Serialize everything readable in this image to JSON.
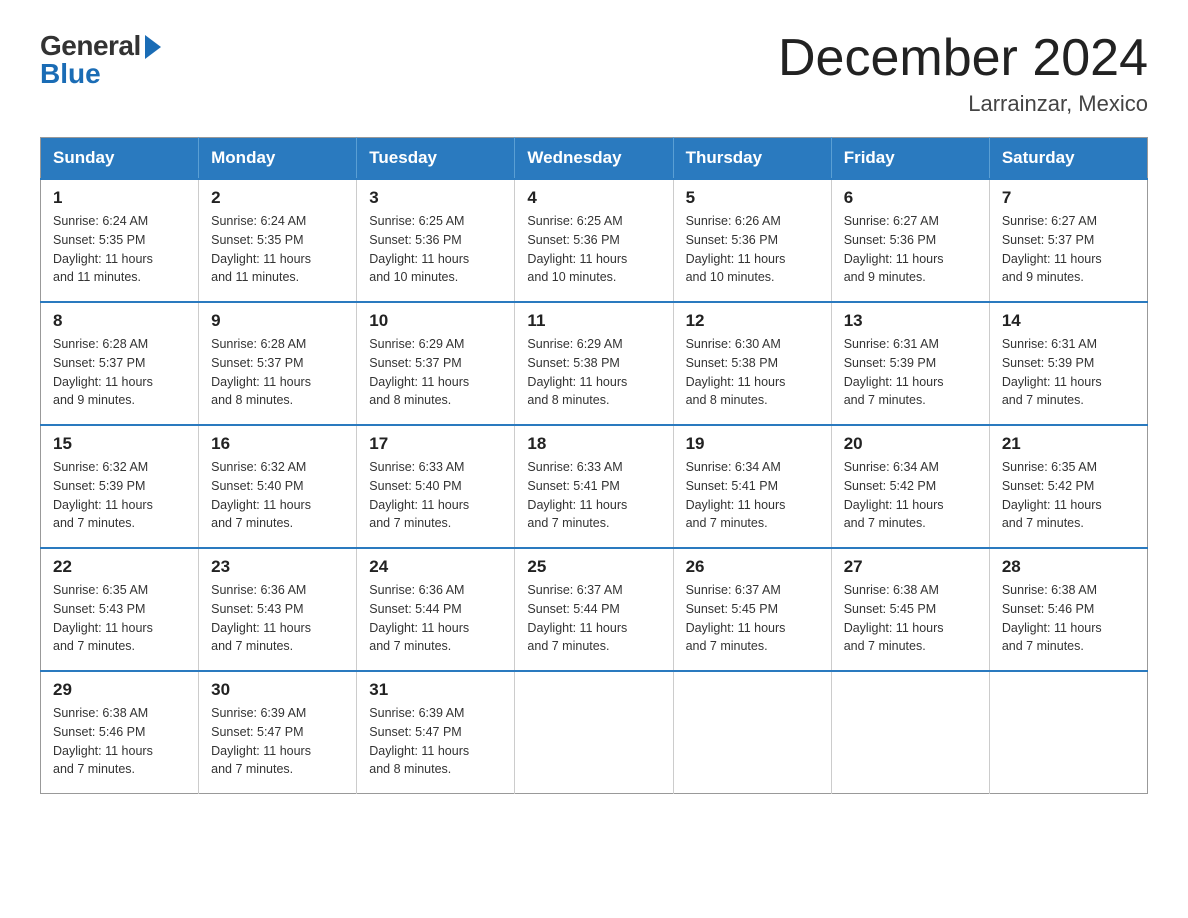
{
  "logo": {
    "general": "General",
    "blue": "Blue"
  },
  "title": "December 2024",
  "location": "Larrainzar, Mexico",
  "days_of_week": [
    "Sunday",
    "Monday",
    "Tuesday",
    "Wednesday",
    "Thursday",
    "Friday",
    "Saturday"
  ],
  "weeks": [
    [
      {
        "day": "1",
        "sunrise": "6:24 AM",
        "sunset": "5:35 PM",
        "daylight": "11 hours and 11 minutes."
      },
      {
        "day": "2",
        "sunrise": "6:24 AM",
        "sunset": "5:35 PM",
        "daylight": "11 hours and 11 minutes."
      },
      {
        "day": "3",
        "sunrise": "6:25 AM",
        "sunset": "5:36 PM",
        "daylight": "11 hours and 10 minutes."
      },
      {
        "day": "4",
        "sunrise": "6:25 AM",
        "sunset": "5:36 PM",
        "daylight": "11 hours and 10 minutes."
      },
      {
        "day": "5",
        "sunrise": "6:26 AM",
        "sunset": "5:36 PM",
        "daylight": "11 hours and 10 minutes."
      },
      {
        "day": "6",
        "sunrise": "6:27 AM",
        "sunset": "5:36 PM",
        "daylight": "11 hours and 9 minutes."
      },
      {
        "day": "7",
        "sunrise": "6:27 AM",
        "sunset": "5:37 PM",
        "daylight": "11 hours and 9 minutes."
      }
    ],
    [
      {
        "day": "8",
        "sunrise": "6:28 AM",
        "sunset": "5:37 PM",
        "daylight": "11 hours and 9 minutes."
      },
      {
        "day": "9",
        "sunrise": "6:28 AM",
        "sunset": "5:37 PM",
        "daylight": "11 hours and 8 minutes."
      },
      {
        "day": "10",
        "sunrise": "6:29 AM",
        "sunset": "5:37 PM",
        "daylight": "11 hours and 8 minutes."
      },
      {
        "day": "11",
        "sunrise": "6:29 AM",
        "sunset": "5:38 PM",
        "daylight": "11 hours and 8 minutes."
      },
      {
        "day": "12",
        "sunrise": "6:30 AM",
        "sunset": "5:38 PM",
        "daylight": "11 hours and 8 minutes."
      },
      {
        "day": "13",
        "sunrise": "6:31 AM",
        "sunset": "5:39 PM",
        "daylight": "11 hours and 7 minutes."
      },
      {
        "day": "14",
        "sunrise": "6:31 AM",
        "sunset": "5:39 PM",
        "daylight": "11 hours and 7 minutes."
      }
    ],
    [
      {
        "day": "15",
        "sunrise": "6:32 AM",
        "sunset": "5:39 PM",
        "daylight": "11 hours and 7 minutes."
      },
      {
        "day": "16",
        "sunrise": "6:32 AM",
        "sunset": "5:40 PM",
        "daylight": "11 hours and 7 minutes."
      },
      {
        "day": "17",
        "sunrise": "6:33 AM",
        "sunset": "5:40 PM",
        "daylight": "11 hours and 7 minutes."
      },
      {
        "day": "18",
        "sunrise": "6:33 AM",
        "sunset": "5:41 PM",
        "daylight": "11 hours and 7 minutes."
      },
      {
        "day": "19",
        "sunrise": "6:34 AM",
        "sunset": "5:41 PM",
        "daylight": "11 hours and 7 minutes."
      },
      {
        "day": "20",
        "sunrise": "6:34 AM",
        "sunset": "5:42 PM",
        "daylight": "11 hours and 7 minutes."
      },
      {
        "day": "21",
        "sunrise": "6:35 AM",
        "sunset": "5:42 PM",
        "daylight": "11 hours and 7 minutes."
      }
    ],
    [
      {
        "day": "22",
        "sunrise": "6:35 AM",
        "sunset": "5:43 PM",
        "daylight": "11 hours and 7 minutes."
      },
      {
        "day": "23",
        "sunrise": "6:36 AM",
        "sunset": "5:43 PM",
        "daylight": "11 hours and 7 minutes."
      },
      {
        "day": "24",
        "sunrise": "6:36 AM",
        "sunset": "5:44 PM",
        "daylight": "11 hours and 7 minutes."
      },
      {
        "day": "25",
        "sunrise": "6:37 AM",
        "sunset": "5:44 PM",
        "daylight": "11 hours and 7 minutes."
      },
      {
        "day": "26",
        "sunrise": "6:37 AM",
        "sunset": "5:45 PM",
        "daylight": "11 hours and 7 minutes."
      },
      {
        "day": "27",
        "sunrise": "6:38 AM",
        "sunset": "5:45 PM",
        "daylight": "11 hours and 7 minutes."
      },
      {
        "day": "28",
        "sunrise": "6:38 AM",
        "sunset": "5:46 PM",
        "daylight": "11 hours and 7 minutes."
      }
    ],
    [
      {
        "day": "29",
        "sunrise": "6:38 AM",
        "sunset": "5:46 PM",
        "daylight": "11 hours and 7 minutes."
      },
      {
        "day": "30",
        "sunrise": "6:39 AM",
        "sunset": "5:47 PM",
        "daylight": "11 hours and 7 minutes."
      },
      {
        "day": "31",
        "sunrise": "6:39 AM",
        "sunset": "5:47 PM",
        "daylight": "11 hours and 8 minutes."
      },
      null,
      null,
      null,
      null
    ]
  ],
  "labels": {
    "sunrise": "Sunrise:",
    "sunset": "Sunset:",
    "daylight": "Daylight:"
  }
}
